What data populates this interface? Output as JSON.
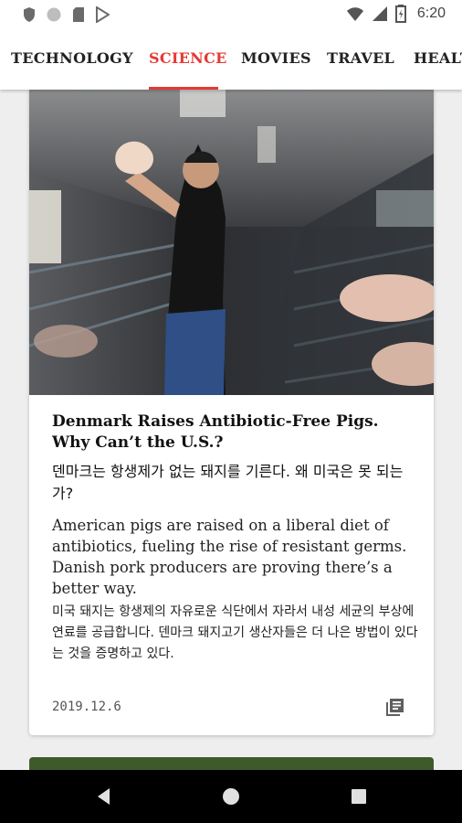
{
  "status_bar": {
    "time": "6:20",
    "left_icons": [
      "shield-icon",
      "circle-icon",
      "sd-card-icon",
      "play-store-icon"
    ],
    "right_icons": [
      "wifi-icon",
      "signal-icon",
      "battery-icon"
    ]
  },
  "tabs": [
    {
      "label": "TECHNOLOGY",
      "active": false
    },
    {
      "label": "SCIENCE",
      "active": true
    },
    {
      "label": "MOVIES",
      "active": false
    },
    {
      "label": "TRAVEL",
      "active": false
    },
    {
      "label": "HEALTH",
      "active": false
    }
  ],
  "colors": {
    "accent": "#e53935",
    "navbar": "#000000",
    "background": "#eeeeee"
  },
  "article": {
    "headline_en": "Denmark Raises Antibiotic-Free Pigs. Why Can’t the U.S.?",
    "headline_ko": "덴마크는 항생제가 없는 돼지를 기른다. 왜 미국은 못 되는가?",
    "summary_en": "American pigs are raised on a liberal diet of antibiotics, fueling the rise of resistant germs. Danish pork producers are proving there’s a better way.",
    "summary_ko": "미국 돼지는 항생제의 자유로운 식단에서 자라서 내성 세균의 부상에 연료를 공급합니다. 덴마크 돼지고기 생산자들은 더 나은 방법이 있다는 것을 증명하고 있다.",
    "date": "2019.12.6",
    "icon": "article-icon"
  },
  "nav": [
    "back-icon",
    "home-icon",
    "recents-icon"
  ]
}
